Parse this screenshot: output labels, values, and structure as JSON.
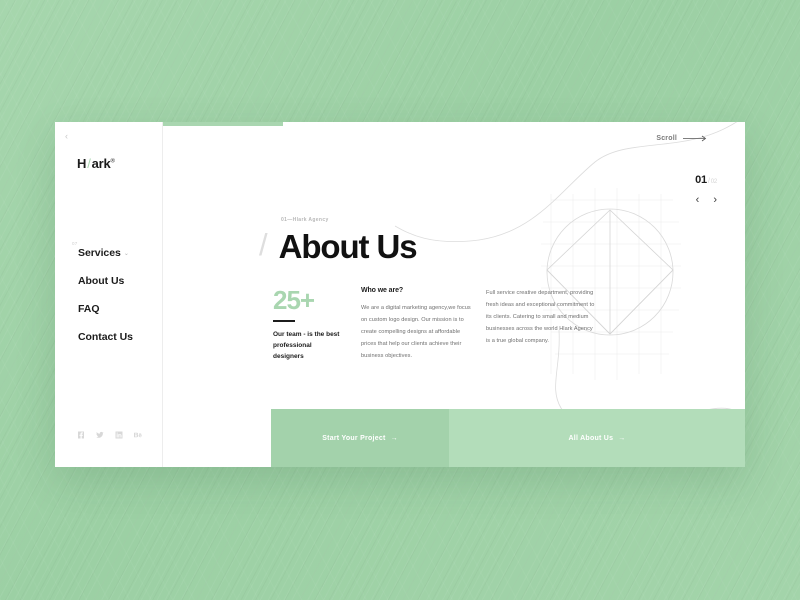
{
  "background": {
    "color": "#a0d3a8"
  },
  "card": {
    "accent_green": "#a9d6b0",
    "cta_primary_green": "#a3d2ab",
    "cta_secondary_green": "#b3ddba"
  },
  "sidebar": {
    "back_icon": "‹",
    "logo": {
      "prefix": "H",
      "slash": "/",
      "suffix": "ark",
      "mark": "®"
    },
    "nav_index": "07",
    "items": [
      {
        "label": "Services",
        "has_caret": true,
        "caret": "⌄"
      },
      {
        "label": "About Us",
        "has_caret": false,
        "caret": ""
      },
      {
        "label": "FAQ",
        "has_caret": false,
        "caret": ""
      },
      {
        "label": "Contact Us",
        "has_caret": false,
        "caret": ""
      }
    ],
    "socials": [
      {
        "name": "facebook-icon"
      },
      {
        "name": "twitter-icon"
      },
      {
        "name": "linkedin-icon"
      },
      {
        "name": "behance-icon"
      }
    ]
  },
  "header": {
    "scroll_label": "Scroll",
    "scroll_arrow_icon": "long-arrow-right-icon"
  },
  "slider": {
    "current": "01",
    "separator": "/",
    "total": "02",
    "prev_icon": "‹",
    "next_icon": "›"
  },
  "main": {
    "eyebrow": "01—Hlark Agency",
    "headline_slash": "/",
    "headline": "About Us",
    "stat": {
      "number": "25+",
      "caption": "Our team - is the best professional designers"
    },
    "columns": [
      {
        "title": "Who we are?",
        "body": "We are a digital marketing agency,we focus on custom logo design. Our mission is to create compelling designs at affordable prices that help our clients achieve their business objectives."
      },
      {
        "title": "",
        "body": "Full service creative department, providing fresh ideas and exceptional commitment to its clients. Catering to small and medium businesses across the world Hlark Agency is a true global company."
      }
    ]
  },
  "cta": {
    "primary": {
      "label": "Start Your Project",
      "arrow": "→"
    },
    "secondary": {
      "label": "All About Us",
      "arrow": "→"
    }
  }
}
